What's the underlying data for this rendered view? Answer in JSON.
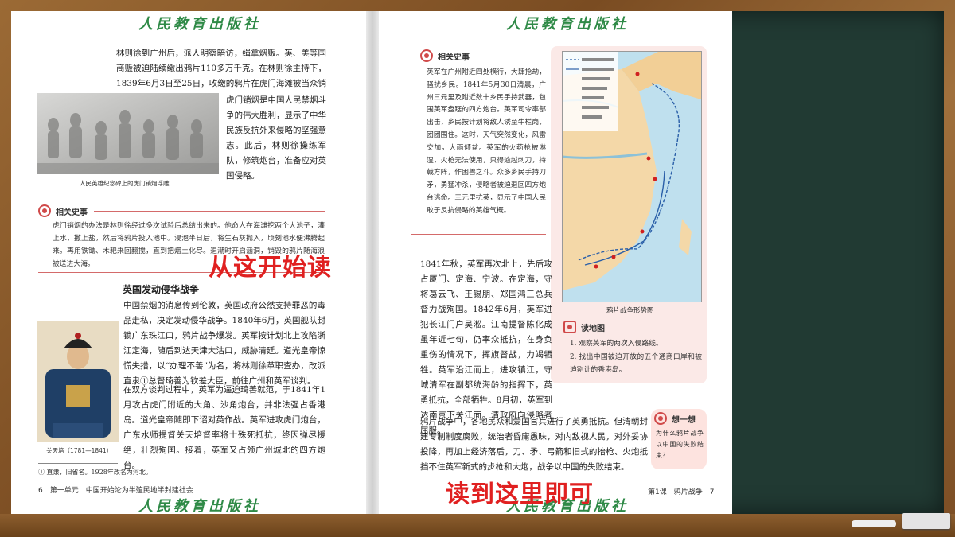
{
  "publisher": "人民教育出版社",
  "left_page": {
    "para1": "林则徐到广州后，派人明察暗访，缉拿烟贩。英、美等国商贩被迫陆续缴出鸦片110多万千克。在林则徐主持下，1839年6月3日至25日，收缴的鸦片在虎门海滩被当众销毁。",
    "para2": "虎门销烟是中国人民禁烟斗争的伟大胜利，显示了中华民族反抗外来侵略的坚强意志。此后，林则徐操练军队，修筑炮台，准备应对英国侵略。",
    "relief_caption": "人民英雄纪念碑上的虎门销烟浮雕",
    "related_title": "相关史事",
    "related_text": "虎门销烟的办法是林则徐经过多次试验后总结出来的。他命人在海滩挖两个大池子，灌上水，撒上盐，然后将鸦片投入池中。浸泡半日后，将生石灰抛入，顷刻池水便沸腾起来。再用铁锄、木耙来回翻搅，直到把烟土化尽。退潮时开启涵洞，销毁的鸦片随海浪被送进大海。",
    "war_heading": "英国发动侵华战争",
    "war_para1": "中国禁烟的消息传到伦敦，英国政府公然支持罪恶的毒品走私，决定发动侵华战争。1840年6月，英国舰队封锁广东珠江口，鸦片战争爆发。英军按计划北上攻陷浙江定海，随后到达天津大沽口，威胁清廷。道光皇帝惊慌失措，以“办理不善”为名，将林则徐革职查办，改派直隶①总督琦善为钦差大臣，前往广州和英军谈判。",
    "war_para2": "在双方谈判过程中，英军为逼迫琦善就范，于1841年1月攻占虎门附近的大角、沙角炮台，并非法强占香港岛。道光皇帝随即下诏对英作战。英军进攻虎门炮台，广东水师提督关天培督率将士殊死抵抗，终因弹尽援绝，壮烈殉国。接着，英军又占领广州城北的四方炮台。",
    "portrait_caption": "关天培（1781—1841）",
    "footnote": "① 直隶，旧省名。1928年改名为河北。",
    "footer": "6　第一单元　中国开始沦为半殖民地半封建社会"
  },
  "right_page": {
    "related_title": "相关史事",
    "related_text": "英军在广州附近四处横行，大肆抢劫，骚扰乡民。1841年5月30日清晨，广州三元里及附近数十乡民手持武器，包围英军盘踞的四方炮台。英军司令率部出击，乡民按计划将敌人诱至牛栏岗，团团围住。这时，天气突然变化，风雷交加，大雨倾盆。英军的火药枪被淋湿，火枪无法使用，只得逾越刺刀，持戟方阵，作困兽之斗。众多乡民手持刀矛，勇猛冲杀，侵略者被迫退回四方炮台逃命。三元里抗英，显示了中国人民敢于反抗侵略的英雄气概。",
    "main_para1": "1841年秋，英军再次北上，先后攻占厦门、定海、宁波。在定海，守将葛云飞、王锡朋、郑国鸿三总兵督力战殉国。1842年6月，英军进犯长江门户吴淞。江南提督陈化成虽年近七旬，仍率众抵抗，在身负重伤的情况下，挥旗督战，力竭牺牲。英军沿江而上，进攻镇江，守城清军在副都统海龄的指挥下，英勇抵抗，全部牺牲。8月初，英军到达南京下关江面。清政府向侵略者屈服。",
    "main_para2": "鸦片战争中，各地民众和爱国官兵进行了英勇抵抗。但清朝封建专制制度腐败，统治者昏庸愚昧，对内敌视人民，对外妥协投降，再加上经济落后，刀、矛、弓箭和旧式的抬枪、火炮抵挡不住英军新式的步枪和大炮，战争以中国的失败结束。",
    "map_caption": "鸦片战争形势图",
    "read_map_title": "读地图",
    "read_map_items": [
      "1. 观察英军的两次入侵路线。",
      "2. 找出中国被迫开放的五个通商口岸和被迫割让的香港岛。"
    ],
    "think_title": "想一想",
    "think_text": "为什么鸦片战争以中国的失败结束？",
    "footer": "第1课　鸦片战争　7"
  },
  "overlays": {
    "start": "从这开始读",
    "end": "读到这里即可"
  }
}
